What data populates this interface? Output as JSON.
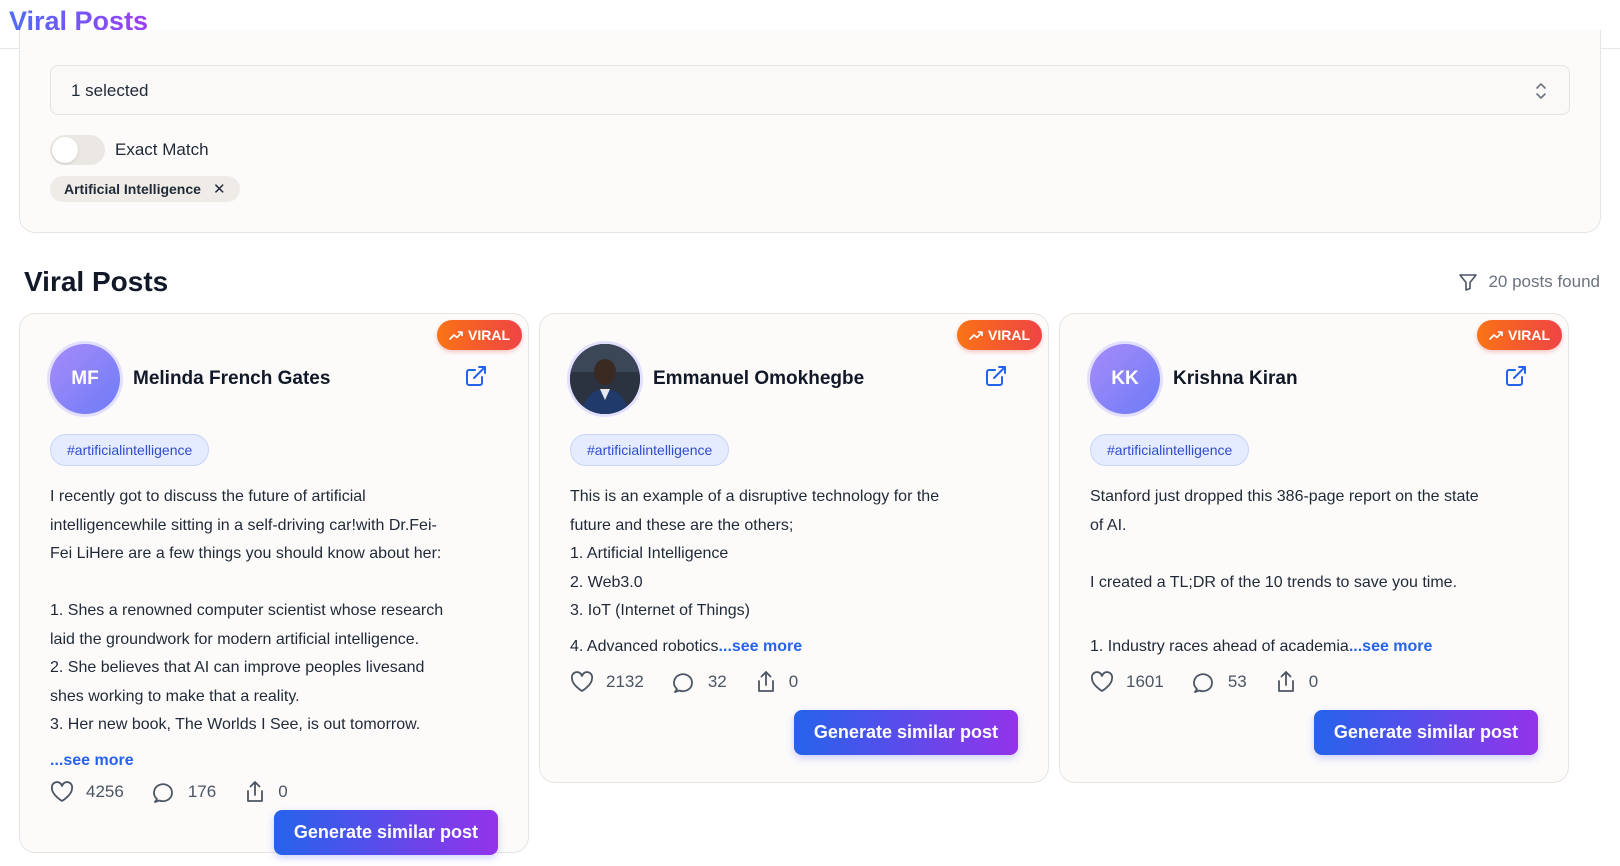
{
  "header": {
    "brand": "Viral Posts"
  },
  "filters": {
    "select_value": "1 selected",
    "exact_match_label": "Exact Match",
    "exact_match_on": false,
    "chip_label": "Artificial Intelligence"
  },
  "section": {
    "title": "Viral Posts",
    "found": "20 posts found"
  },
  "colors": {
    "accent_blue": "#2563eb",
    "accent_purple": "#9333ea",
    "viral_orange": "#f97316"
  },
  "posts": [
    {
      "badge": "VIRAL",
      "initials": "MF",
      "author": "Melinda French Gates",
      "tag": "#artificialintelligence",
      "lines": [
        "I recently got to discuss the future of artificial",
        "intelligencewhile sitting in a self-driving car!with Dr.Fei-",
        "Fei LiHere are a few things you should know about her:",
        "",
        "1. Shes a renowned computer scientist whose research",
        "laid the groundwork for modern artificial intelligence.",
        "2. She believes that AI can improve peoples livesand",
        "shes working to make that a reality.",
        "3. Her new book, The Worlds I See, is out tomorrow."
      ],
      "see_more": "...see more",
      "likes": "4256",
      "comments": "176",
      "shares": "0",
      "button": "Generate similar post"
    },
    {
      "badge": "VIRAL",
      "initials": "",
      "author": "Emmanuel Omokhegbe",
      "tag": "#artificialintelligence",
      "lines": [
        "This is an example of a disruptive technology for the",
        "future and these are the others;",
        "1. Artificial Intelligence",
        "2. Web3.0",
        "3. IoT (Internet of Things)"
      ],
      "last_line": "4. Advanced robotics",
      "see_more": "...see more",
      "likes": "2132",
      "comments": "32",
      "shares": "0",
      "button": "Generate similar post"
    },
    {
      "badge": "VIRAL",
      "initials": "KK",
      "author": "Krishna Kiran",
      "tag": "#artificialintelligence",
      "lines": [
        "Stanford just dropped this 386-page report on the state",
        "of AI.",
        "",
        "I created a TL;DR of the 10 trends to save you time.",
        ""
      ],
      "last_line": "1. Industry races ahead of academia",
      "see_more": "...see more",
      "likes": "1601",
      "comments": "53",
      "shares": "0",
      "button": "Generate similar post"
    }
  ]
}
